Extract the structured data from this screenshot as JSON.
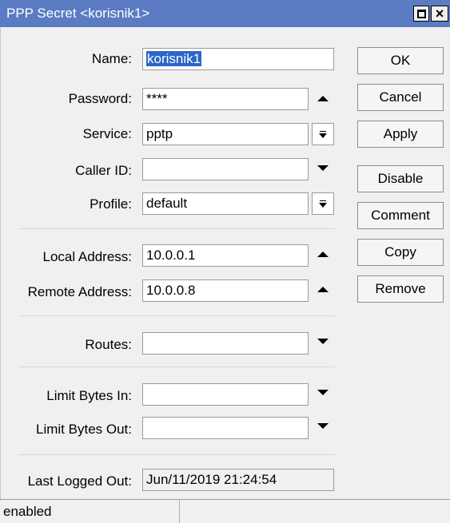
{
  "window": {
    "title": "PPP Secret <korisnik1>",
    "close_glyph": "×"
  },
  "form": {
    "name_label": "Name:",
    "name_value": "korisnik1",
    "password_label": "Password:",
    "password_value": "****",
    "service_label": "Service:",
    "service_value": "pptp",
    "caller_id_label": "Caller ID:",
    "caller_id_value": "",
    "profile_label": "Profile:",
    "profile_value": "default",
    "local_address_label": "Local Address:",
    "local_address_value": "10.0.0.1",
    "remote_address_label": "Remote Address:",
    "remote_address_value": "10.0.0.8",
    "routes_label": "Routes:",
    "routes_value": "",
    "limit_in_label": "Limit Bytes In:",
    "limit_in_value": "",
    "limit_out_label": "Limit Bytes Out:",
    "limit_out_value": "",
    "last_logged_out_label": "Last Logged Out:",
    "last_logged_out_value": "Jun/11/2019 21:24:54"
  },
  "buttons": {
    "ok": "OK",
    "cancel": "Cancel",
    "apply": "Apply",
    "disable": "Disable",
    "comment": "Comment",
    "copy": "Copy",
    "remove": "Remove"
  },
  "status": {
    "text": "enabled"
  }
}
